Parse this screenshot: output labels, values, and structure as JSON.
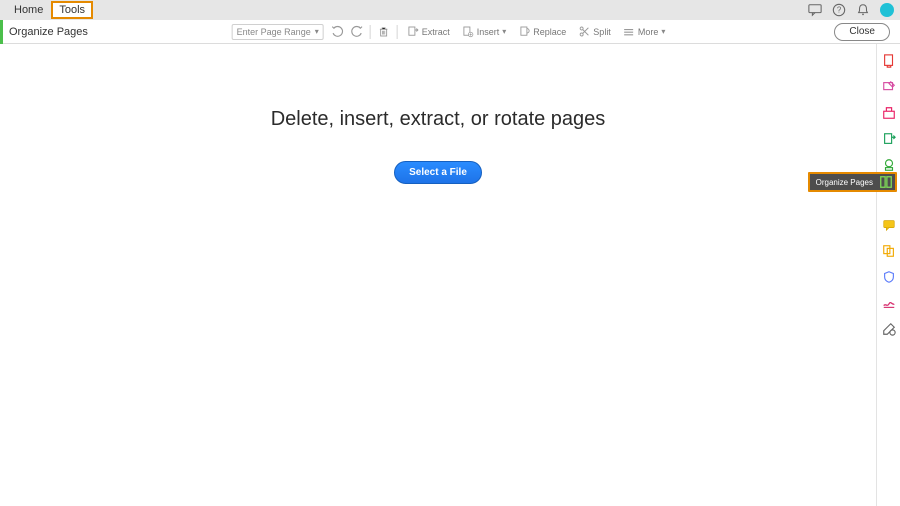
{
  "topbar": {
    "home": "Home",
    "tools": "Tools"
  },
  "toolbar": {
    "title": "Organize Pages",
    "page_range_placeholder": "Enter Page Range",
    "extract": "Extract",
    "insert": "Insert",
    "replace": "Replace",
    "split": "Split",
    "more": "More",
    "close": "Close"
  },
  "main": {
    "headline": "Delete, insert, extract, or rotate pages",
    "select_file": "Select a File"
  },
  "float": {
    "organize_pages": "Organize Pages"
  }
}
